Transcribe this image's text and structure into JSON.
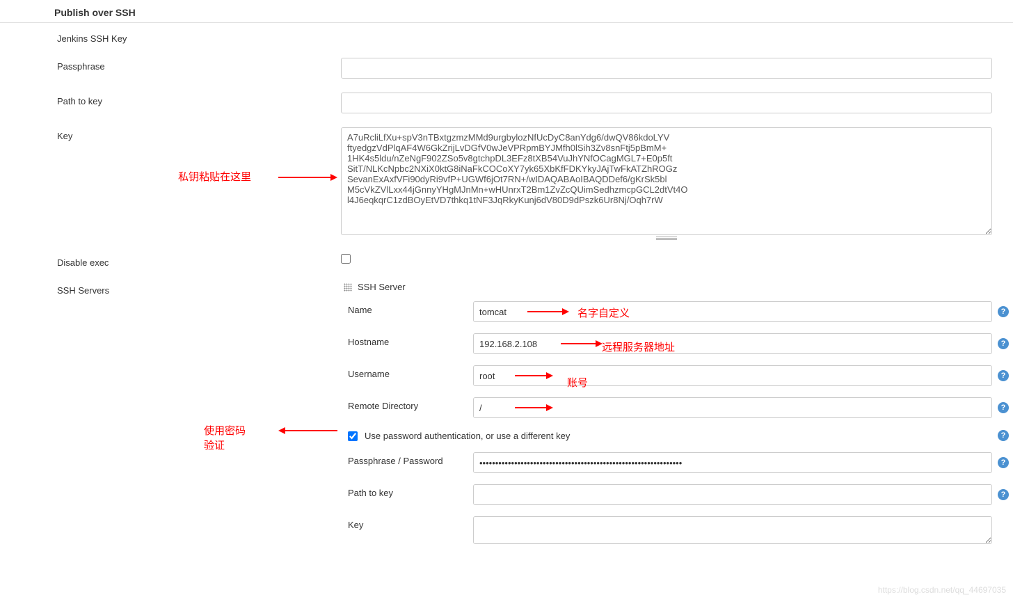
{
  "section": {
    "title": "Publish over SSH"
  },
  "labels": {
    "jenkins_ssh_key": "Jenkins SSH Key",
    "passphrase": "Passphrase",
    "path_to_key": "Path to key",
    "key": "Key",
    "disable_exec": "Disable exec",
    "ssh_servers": "SSH Servers",
    "ssh_server": "SSH Server",
    "name": "Name",
    "hostname": "Hostname",
    "username": "Username",
    "remote_directory": "Remote Directory",
    "use_password_auth": "Use password authentication, or use a different key",
    "passphrase_password": "Passphrase / Password",
    "path_to_key2": "Path to key",
    "key2": "Key"
  },
  "values": {
    "passphrase": "",
    "path_to_key": "",
    "key_text": "A7uRcliLfXu+spV3nTBxtgzmzMMd9urgbylozNfUcDyC8anYdg6/dwQV86kdoLYV\nftyedgzVdPlqAF4W6GkZrijLvDGfV0wJeVPRpmBYJMfh0lSih3Zv8snFtj5pBmM+\n1HK4s5ldu/nZeNgF902ZSo5v8gtchpDL3EFz8tXB54VuJhYNfOCagMGL7+E0p5ft\nSitT/NLKcNpbc2NXiX0ktG8iNaFkCOCoXY7yk65XbKfFDKYkyJAjTwFkATZhROGz\nSevanExAxfVFi90dyRi9vfP+UGWf6jOt7RN+/wIDAQABAoIBAQDDef6/gKrSk5bl\nM5cVkZVlLxx44jGnnyYHgMJnMn+wHUnrxT2Bm1ZvZcQUimSedhzmcpGCL2dtVt4O\nl4J6eqkqrC1zdBOyEtVD7thkq1tNF3JqRkyKunj6dV80D9dPszk6Ur8Nj/Oqh7rW",
    "disable_exec": false,
    "name": "tomcat",
    "hostname": "192.168.2.108",
    "username": "root",
    "remote_directory": "/",
    "use_password_auth": true,
    "password_masked": "••••••••••••••••••••••••••••••••••••••••••••••••••••••••••••••••",
    "path_to_key2": "",
    "key2": ""
  },
  "annotations": {
    "private_key_paste": "私钥粘贴在这里",
    "name_custom": "名字自定义",
    "remote_server_addr": "远程服务器地址",
    "account": "账号",
    "use_password_verify": "使用密码\n验证"
  },
  "watermark": "https://blog.csdn.net/qq_44697035"
}
